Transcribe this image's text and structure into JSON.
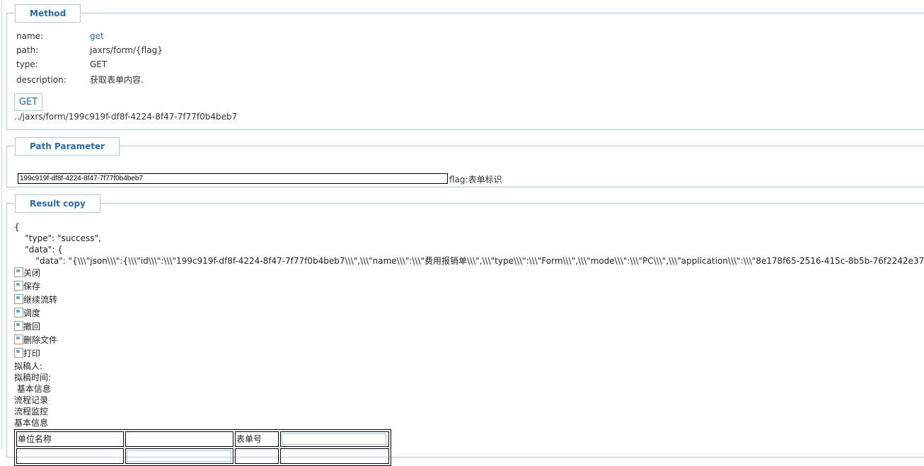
{
  "method_section": {
    "legend": "Method",
    "fields": [
      {
        "key": "name:",
        "value": "get"
      },
      {
        "key": "path:",
        "value": "jaxrs/form/{flag}"
      },
      {
        "key": "type:",
        "value": "GET"
      },
      {
        "key": "description:",
        "value": "获取表单内容."
      }
    ],
    "get_button": "GET",
    "url": "../jaxrs/form/199c919f-df8f-4224-8f47-7f77f0b4beb7"
  },
  "path_section": {
    "legend": "Path Parameter",
    "input_value": "199c919f-df8f-4224-8f47-7f77f0b4beb7",
    "param_desc": "flag:表单标识"
  },
  "result_section": {
    "legend": "Result copy",
    "lines": [
      "{",
      "    \"type\": \"success\",",
      "    \"data\": {",
      "        \"data\": \"{\\\\\\\"json\\\\\\\":{\\\\\\\"id\\\\\\\":\\\\\\\"199c919f-df8f-4224-8f47-7f77f0b4beb7\\\\\\\",\\\\\\\"name\\\\\\\":\\\\\\\"费用报销单\\\\\\\",\\\\\\\"type\\\\\\\":\\\\\\\"Form\\\\\\\",\\\\\\\"mode\\\\\\\":\\\\\\\"PC\\\\\\\",\\\\\\\"application\\\\\\\":\\\\\\\"8e178f65-2516-415c-8b5b-76f2242e37"
    ],
    "actions": [
      "关闭",
      "保存",
      "继续流转",
      "调度",
      "撤回",
      "删除文件",
      "打印"
    ],
    "texts": [
      "拟稿人:",
      "拟稿时间:",
      " 基本信息",
      "流程记录",
      "流程监控",
      "基本信息"
    ],
    "table": {
      "unit_label": "单位名称",
      "form_no_label": "表单号"
    }
  }
}
